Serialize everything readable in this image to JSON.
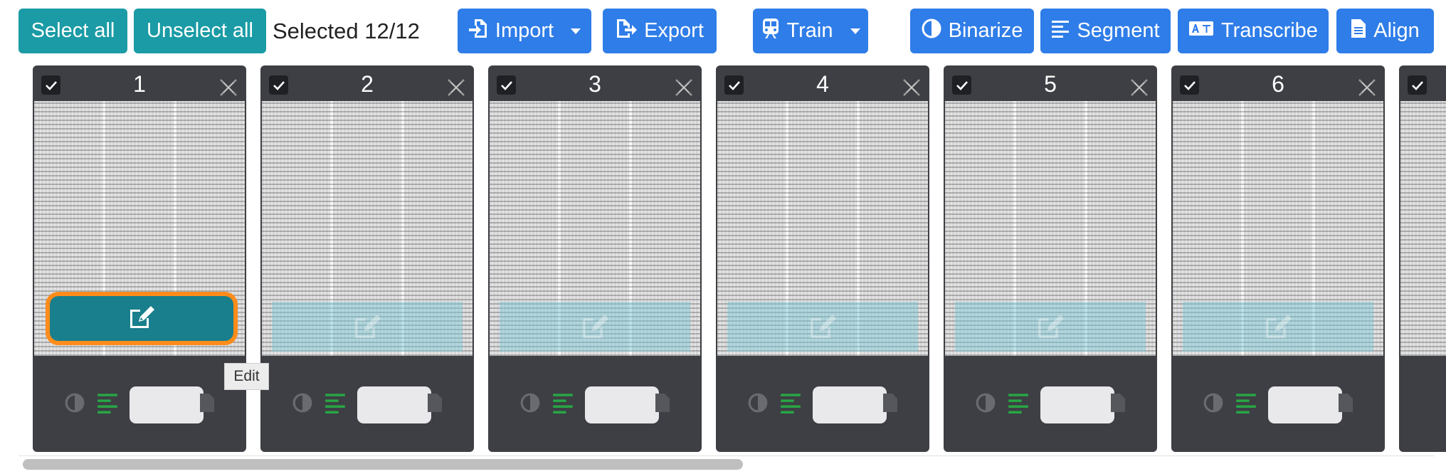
{
  "toolbar": {
    "select_all": "Select all",
    "unselect_all": "Unselect all",
    "selected_count": "Selected 12/12",
    "import": "Import",
    "export": "Export",
    "train": "Train",
    "binarize": "Binarize",
    "segment": "Segment",
    "transcribe": "Transcribe",
    "align": "Align"
  },
  "cards": [
    {
      "number": "1"
    },
    {
      "number": "2"
    },
    {
      "number": "3"
    },
    {
      "number": "4"
    },
    {
      "number": "5"
    },
    {
      "number": "6"
    }
  ],
  "tooltip": "Edit",
  "colors": {
    "teal": "#1a9ba5",
    "blue": "#2f7de8",
    "card": "#3d3f44",
    "edit_button": "#197f8c",
    "focus_ring": "#ff8c1a",
    "status_green": "#28a745"
  },
  "icons": [
    "import-icon",
    "export-icon",
    "train-icon",
    "binarize-icon",
    "segment-icon",
    "transcribe-icon",
    "align-icon",
    "checkbox-icon",
    "close-icon",
    "edit-icon",
    "binarize-status-icon",
    "segment-status-icon",
    "document-icon"
  ]
}
